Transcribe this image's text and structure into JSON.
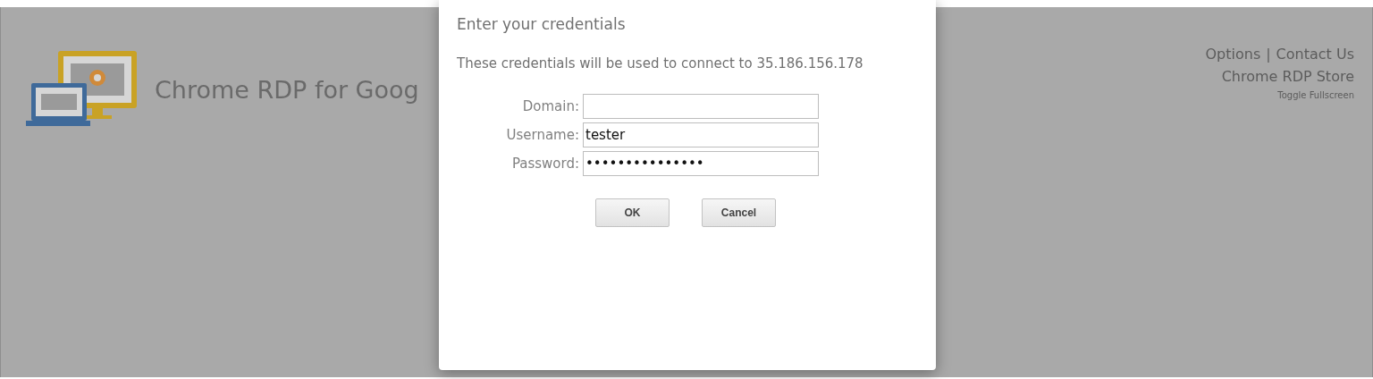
{
  "header": {
    "title": "Chrome RDP for Goog"
  },
  "links": [
    {
      "label": "Options"
    },
    {
      "label": "|"
    },
    {
      "label": "Contact Us"
    }
  ],
  "store_link": "Chrome RDP Store",
  "fullscreen_link": "Toggle Fullscreen",
  "dialog": {
    "title": "Enter your credentials",
    "message": "These credentials will be used to connect to 35.186.156.178",
    "fields": [
      {
        "label": "Domain:"
      },
      {
        "label": "Username:",
        "value": "tester"
      },
      {
        "label": "Password:",
        "value": "•••••••••••••••"
      }
    ],
    "buttons": [
      "OK",
      "Cancel"
    ]
  }
}
